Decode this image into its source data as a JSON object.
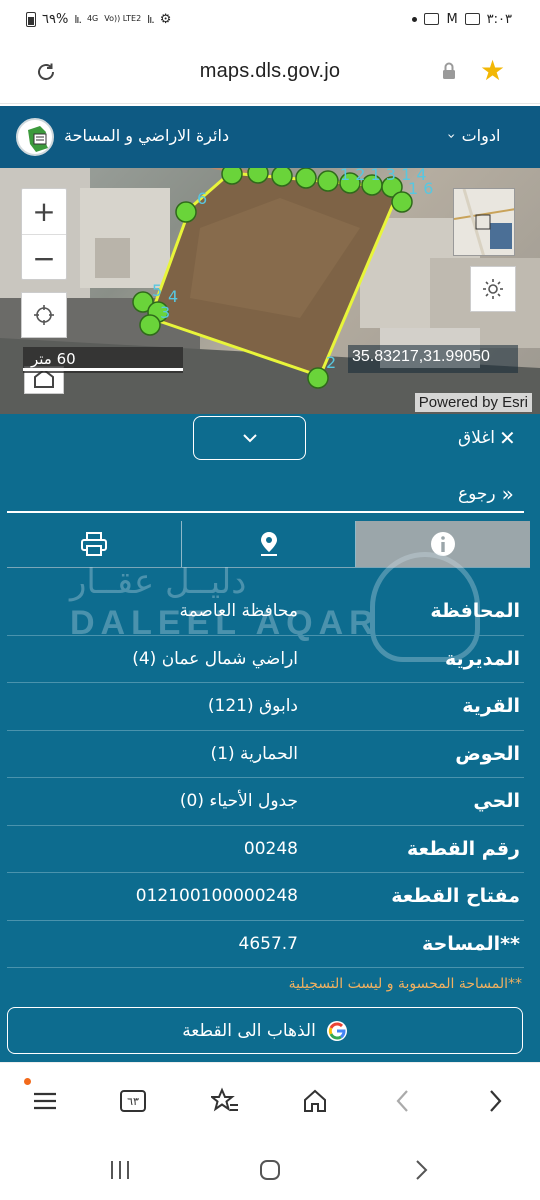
{
  "status_bar": {
    "battery": "٦٩%",
    "network": "4G",
    "volte": "Vo)) LTE2",
    "time": "٣:٠٣"
  },
  "browser": {
    "url": "maps.dls.gov.jo",
    "tab_count": "٦٣"
  },
  "app_header": {
    "tools_label": "ادوات",
    "department_title": "دائرة الاراضي و المساحة"
  },
  "map": {
    "scale_label": "60 متر",
    "coordinates": "35.83217,31.99050",
    "attribution": "Powered by Esri",
    "vertex_labels": [
      "1",
      "2",
      "3",
      "4",
      "5",
      "6",
      "8",
      "1",
      "2",
      "3",
      "1",
      "4"
    ]
  },
  "panel": {
    "close_label": "اغلاق",
    "back_label": "رجوع",
    "watermark_ar": "دليــل عقــار",
    "watermark_en": "DALEEL AQAR",
    "rows": [
      {
        "label": "المحافظة",
        "value": "محافظة العاصمة"
      },
      {
        "label": "المديرية",
        "value": "اراضي شمال عمان (4)"
      },
      {
        "label": "القرية",
        "value": "دابوق (121)"
      },
      {
        "label": "الحوض",
        "value": "الحمارية (1)"
      },
      {
        "label": "الحي",
        "value": "جدول الأحياء (0)"
      },
      {
        "label": "رقم القطعة",
        "value": "00248"
      },
      {
        "label": "مفتاح القطعة",
        "value": "012100100000248"
      },
      {
        "label": "**المساحة",
        "value": "4657.7"
      }
    ],
    "area_note": "**المساحة المحسوبة و ليست التسجيلية",
    "go_to_parcel": "الذهاب الى القطعة"
  },
  "colors": {
    "header_blue": "#0e5a83",
    "panel_blue": "#0d6c8f",
    "parcel_line": "#e8f53a",
    "vertex_green": "#6ad43a",
    "note_orange": "#f0b060",
    "star_yellow": "#f2b705"
  }
}
